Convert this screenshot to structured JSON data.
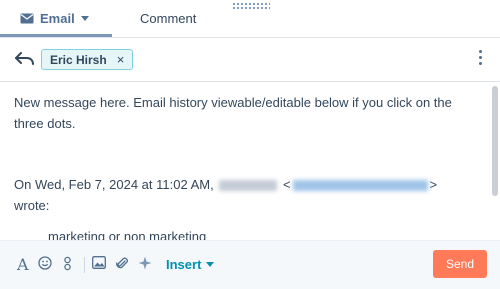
{
  "tabs": {
    "email_label": "Email",
    "comment_label": "Comment"
  },
  "recipients": {
    "chip_label": "Eric Hirsh",
    "chip_remove": "×"
  },
  "body": {
    "message": "New message here. Email history viewable/editable below if you click on the three dots.",
    "quote_prefix": "On Wed, Feb 7, 2024 at 11:02 AM,",
    "quote_lt": "<",
    "quote_gt": ">",
    "quote_suffix": "wrote:",
    "quoted_text": "marketing or non marketing"
  },
  "toolbar": {
    "format_label": "A",
    "insert_label": "Insert",
    "send_label": "Send"
  },
  "colors": {
    "accent": "#ff7a59",
    "link": "#0091ae",
    "chip_border": "#7fd1de",
    "text": "#33475b"
  }
}
